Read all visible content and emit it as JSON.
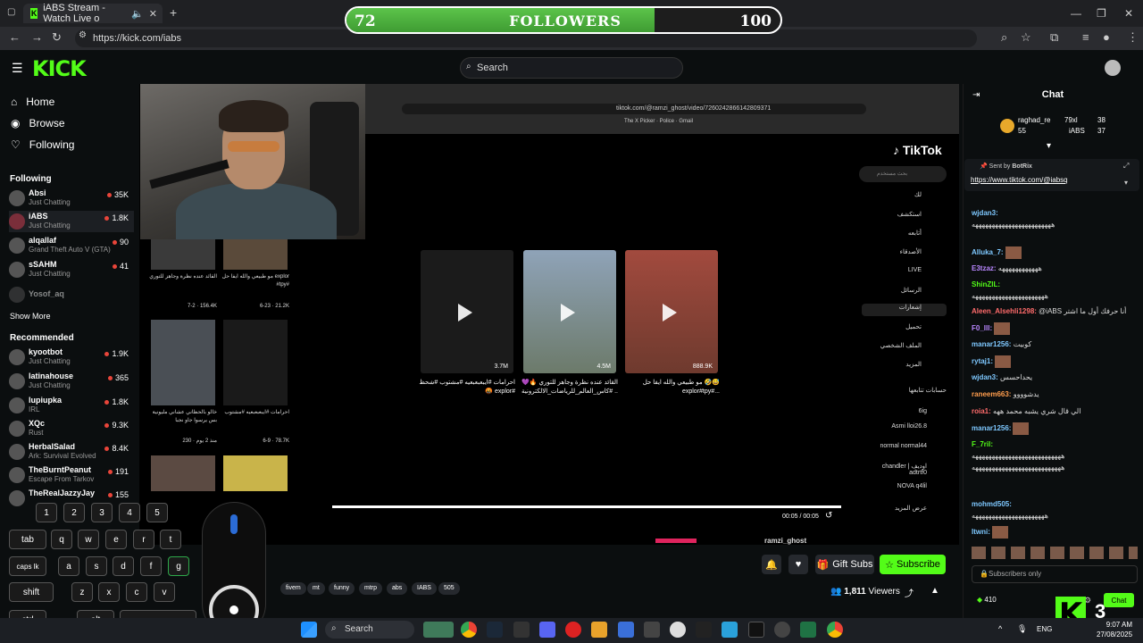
{
  "browser": {
    "tab_title": "iABS Stream - Watch Live o",
    "url": "https://kick.com/iabs",
    "new_tab": "+"
  },
  "goal": {
    "current": "72",
    "label": "FOLLOWERS",
    "target": "100",
    "progress_fraction": 0.71
  },
  "kick": {
    "logo": "KICK",
    "search_placeholder": "Search"
  },
  "sidebar": {
    "nav": [
      {
        "label": "Home",
        "icon": "home-icon"
      },
      {
        "label": "Browse",
        "icon": "compass-icon"
      },
      {
        "label": "Following",
        "icon": "heart-icon"
      }
    ],
    "following_heading": "Following",
    "following": [
      {
        "name": "Absi",
        "game": "Just Chatting",
        "viewers": "35K"
      },
      {
        "name": "iABS",
        "game": "Just Chatting",
        "viewers": "1.8K"
      },
      {
        "name": "alqallaf",
        "game": "Grand Theft Auto V (GTA)",
        "viewers": "90"
      },
      {
        "name": "sSAHM",
        "game": "Just Chatting",
        "viewers": "41"
      },
      {
        "name": "Yosof_aq",
        "game": "",
        "viewers": ""
      }
    ],
    "show_more": "Show More",
    "recommended_heading": "Recommended",
    "recommended": [
      {
        "name": "kyootbot",
        "game": "Just Chatting",
        "viewers": "1.9K"
      },
      {
        "name": "latinahouse",
        "game": "Just Chatting",
        "viewers": "365"
      },
      {
        "name": "lupiupka",
        "game": "IRL",
        "viewers": "1.8K"
      },
      {
        "name": "XQc",
        "game": "Rust",
        "viewers": "9.3K"
      },
      {
        "name": "HerbalSalad",
        "game": "Ark: Survival Evolved",
        "viewers": "8.4K"
      },
      {
        "name": "TheBurntPeanut",
        "game": "Escape From Tarkov",
        "viewers": "191"
      },
      {
        "name": "TheRealJazzyJay",
        "game": "",
        "viewers": "155"
      }
    ]
  },
  "stream": {
    "tiktok_url": "tiktok.com/@ramzi_ghost/video/7260242866142809371",
    "tiktok_logo": "TikTok",
    "tt_search": "بحث مستخدم",
    "tt_menu": [
      "لك",
      "استكشف",
      "أتابعه",
      "الأصدقاء",
      "LIVE",
      "الرسائل",
      "إشعارات",
      "تحميل",
      "الملف الشخصي",
      "المزيد"
    ],
    "tt_following_heading": "حسابات تتابعها",
    "tt_following": [
      "6ig",
      "Asmi lloi26.8",
      "normal normal44",
      "chandler | اوديف adtrtf0",
      "NOVA q4lil",
      "عرض المزيد"
    ],
    "videos": [
      {
        "views": "3.7M",
        "caption": "احرامات  #ايبعبعبعيه #مشتوب #شحظ 🤬 explor#"
      },
      {
        "views": "4.5M",
        "caption": "القائد عنده نظرة وجاهز للتوري 🔥💜 .. #كاس_العالم_للرياضات_الالكترونية"
      },
      {
        "views": "888.9K",
        "caption": "مو طبيعي والله ايفا حل 🤣😅 explor#tpy#..."
      }
    ],
    "left_videos": [
      {
        "caption": "القائد عنده نظرة وجاهز للتوري",
        "stats": "7-2 · 156.4K"
      },
      {
        "caption": "مو طبيعي والله ايفا حل explor #tpy#",
        "stats": "6-23 · 21.2K"
      },
      {
        "caption": "خالو بالحظاني عشاني مليونية بس يرسوا جاو نجبا",
        "stats": "230 · منذ 2 يوم"
      },
      {
        "caption": "احرامات #ايبعبعبعيه #مشتوب",
        "stats": "6-9 · 78.7K"
      }
    ],
    "timecode": "00:05 / 00:05",
    "author": "ramzi_ghost"
  },
  "keyboard": {
    "numbers": [
      "1",
      "2",
      "3",
      "4",
      "5"
    ],
    "row_tab": [
      "tab",
      "q",
      "w",
      "e",
      "r",
      "t"
    ],
    "row_caps": [
      "caps lk",
      "a",
      "s",
      "d",
      "f",
      "g"
    ],
    "row_shift": [
      "shift",
      "z",
      "x",
      "c",
      "v"
    ],
    "row_ctrl": [
      "ctrl",
      "alt"
    ]
  },
  "below": {
    "tags": [
      "fivem",
      "mt",
      "funny",
      "mtrp",
      "abs",
      "IABS",
      "505"
    ],
    "gift_label": "Gift Subs",
    "subscribe_label": "Subscribe",
    "viewers": "1,811",
    "viewers_label": "Viewers"
  },
  "chat": {
    "title": "Chat",
    "leaderboard": [
      {
        "name": "raghad_re",
        "value": "79xl"
      },
      {
        "name": "55",
        "value": ""
      },
      {
        "name": "iABS",
        "value": "38"
      },
      {
        "name": "",
        "value": "37"
      }
    ],
    "pinned_by": "Sent by",
    "pinned_user": "BotRix",
    "pinned_link": "https://www.tiktok.com/@iabsq",
    "messages": [
      {
        "user": "wjdan3:",
        "text": "ههههههههههههههههههههههههه",
        "color": "#7ec8ff"
      },
      {
        "user": "Alluka_7:",
        "text": "",
        "color": "#7ec8ff"
      },
      {
        "user": "E3tzaz:",
        "text": "ههههههههههههه",
        "color": "#b987ff"
      },
      {
        "user": "ShinZIL:",
        "text": "ههههههههههههههههههههههه",
        "color": "#53fc18"
      },
      {
        "user": "Aleen_Alsehli1298:",
        "text": "@iABS أنا حرفك أول ما اشتر",
        "color": "#ff6b6b"
      },
      {
        "user": "F0_lll:",
        "text": "",
        "color": "#b987ff"
      },
      {
        "user": "manar1256:",
        "text": "كوبيت",
        "color": "#7ec8ff"
      },
      {
        "user": "rytaj1:",
        "text": "",
        "color": "#7ec8ff"
      },
      {
        "user": "wjdan3:",
        "text": "يحداحسس",
        "color": "#7ec8ff"
      },
      {
        "user": "raneem663:",
        "text": "يدشوووو",
        "color": "#ff9d4d"
      },
      {
        "user": "roia1:",
        "text": "الي قال شري يشبه محمد ههه",
        "color": "#ff6b6b"
      },
      {
        "user": "manar1256:",
        "text": "",
        "color": "#7ec8ff"
      },
      {
        "user": "F_7ril:",
        "text": "",
        "color": "#53fc18"
      },
      {
        "user": "",
        "text": "هههههههههههههههههههههههههههه",
        "color": "#ffffff"
      },
      {
        "user": "",
        "text": "هههههههههههههههههههههههههههه",
        "color": "#ffffff"
      },
      {
        "user": "mohmd505:",
        "text": "ههههههههههههههههههههههه",
        "color": "#7ec8ff"
      },
      {
        "user": "Itwni:",
        "text": "",
        "color": "#7ec8ff"
      }
    ],
    "input_placeholder": "Subscribers only",
    "points": "410",
    "send_label": "Chat"
  },
  "taskbar": {
    "search": "Search",
    "lang": "ENG",
    "time": "9:07 AM",
    "date": "27/08/2025"
  },
  "overlay": {
    "kick_k": "K",
    "kick_num": "3"
  },
  "colors": {
    "kick_green": "#53fc18",
    "goal_fill": "#4caf3c"
  }
}
